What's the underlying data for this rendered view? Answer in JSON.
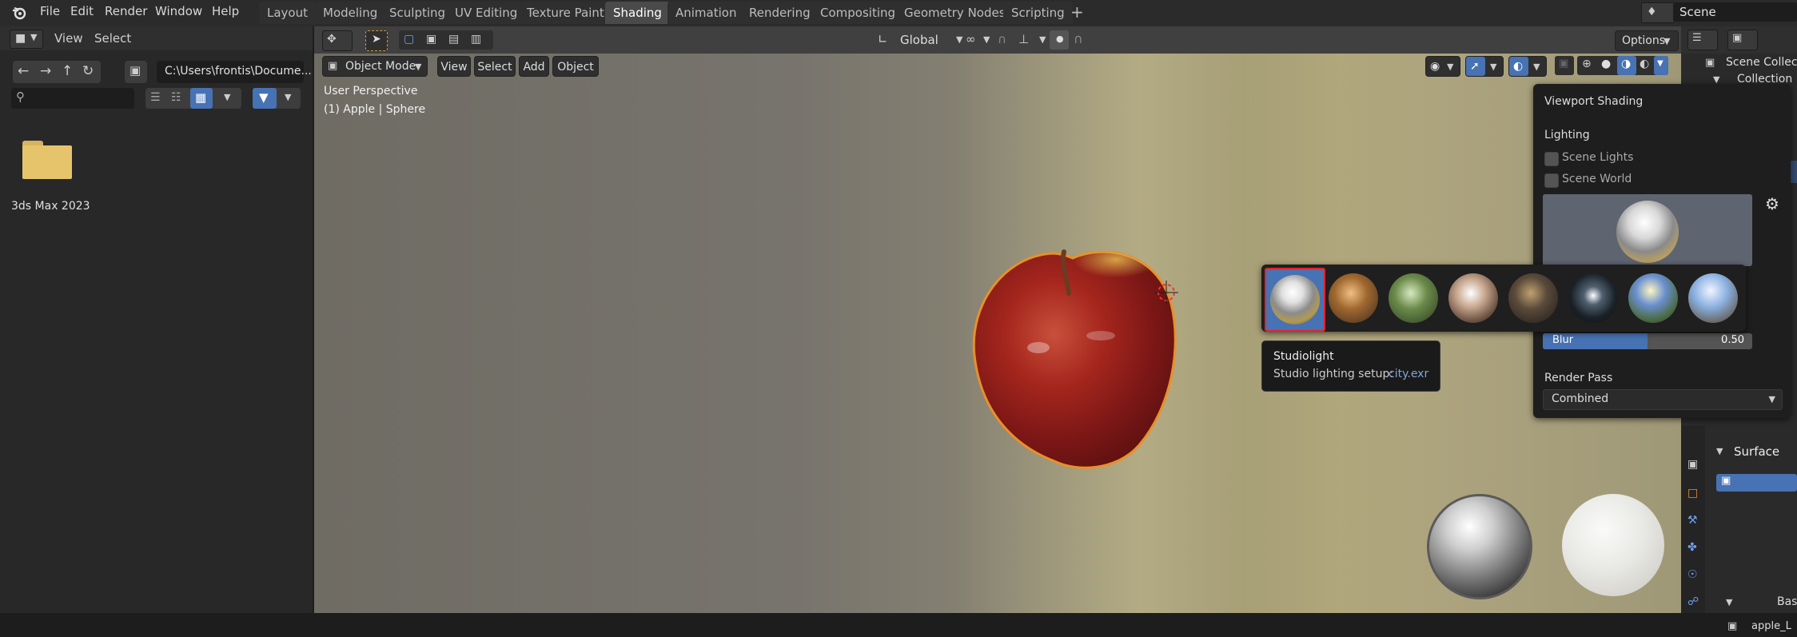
{
  "topbar": {
    "menus": [
      "File",
      "Edit",
      "Render",
      "Window",
      "Help"
    ],
    "workspaces": [
      "Layout",
      "Modeling",
      "Sculpting",
      "UV Editing",
      "Texture Paint",
      "Shading",
      "Animation",
      "Rendering",
      "Compositing",
      "Geometry Nodes",
      "Scripting"
    ],
    "active_workspace": "Shading",
    "add_tab": "+",
    "scene_name": "Scene"
  },
  "filebrowser": {
    "menus": [
      "View",
      "Select"
    ],
    "path": "C:\\Users\\frontis\\Docume...",
    "search_placeholder": "",
    "folder_name": "3ds Max 2023"
  },
  "viewport": {
    "transform_orientation": "Global",
    "options_label": "Options",
    "mode": "Object Mode",
    "menus": [
      "View",
      "Select",
      "Add",
      "Object"
    ],
    "info_line1": "User Perspective",
    "info_line2": "(1) Apple | Sphere"
  },
  "shading_popover": {
    "title": "Viewport Shading",
    "lighting_label": "Lighting",
    "scene_lights": "Scene Lights",
    "scene_world": "Scene World",
    "blur_label": "Blur",
    "blur_value": "0.50",
    "blur_fraction": 0.5,
    "render_pass_label": "Render Pass",
    "render_pass_value": "Combined"
  },
  "tooltip": {
    "title": "Studiolight",
    "desc_label": "Studio lighting setup:",
    "desc_value": "city.exr"
  },
  "outliner": {
    "scene_collection": "Scene Collect",
    "collection": "Collection",
    "surface": "Surface",
    "base": "Base",
    "texture": "apple_L"
  },
  "colors": {
    "accent": "#4772b3",
    "highlight_red": "#e8202a",
    "tooltip_value": "#7ea6d9"
  }
}
